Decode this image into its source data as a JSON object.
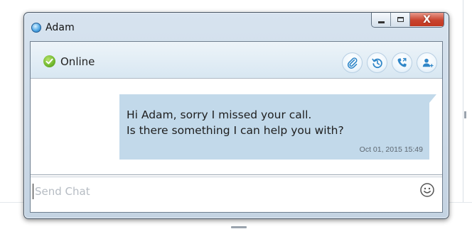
{
  "window": {
    "title": "Adam",
    "controls": {
      "minimize_icon": "minimize-icon",
      "maximize_icon": "maximize-icon",
      "close_label": "X"
    }
  },
  "header": {
    "status": "Online",
    "status_icon": "check-circle-icon",
    "tools": [
      {
        "icon": "paperclip-icon"
      },
      {
        "icon": "history-icon"
      },
      {
        "icon": "phone-icon"
      },
      {
        "icon": "add-user-icon"
      }
    ]
  },
  "messages": [
    {
      "lines": [
        "Hi Adam, sorry I missed your call.",
        "Is there something I can help you with?"
      ],
      "timestamp": "Oct 01, 2015 15:49"
    }
  ],
  "compose": {
    "placeholder": "Send Chat",
    "value": "",
    "emoji_icon": "smiley-icon"
  },
  "colors": {
    "accent": "#2f86c8",
    "bubble": "#c2d9ea",
    "online": "#6fb62c",
    "close": "#c9442f"
  }
}
